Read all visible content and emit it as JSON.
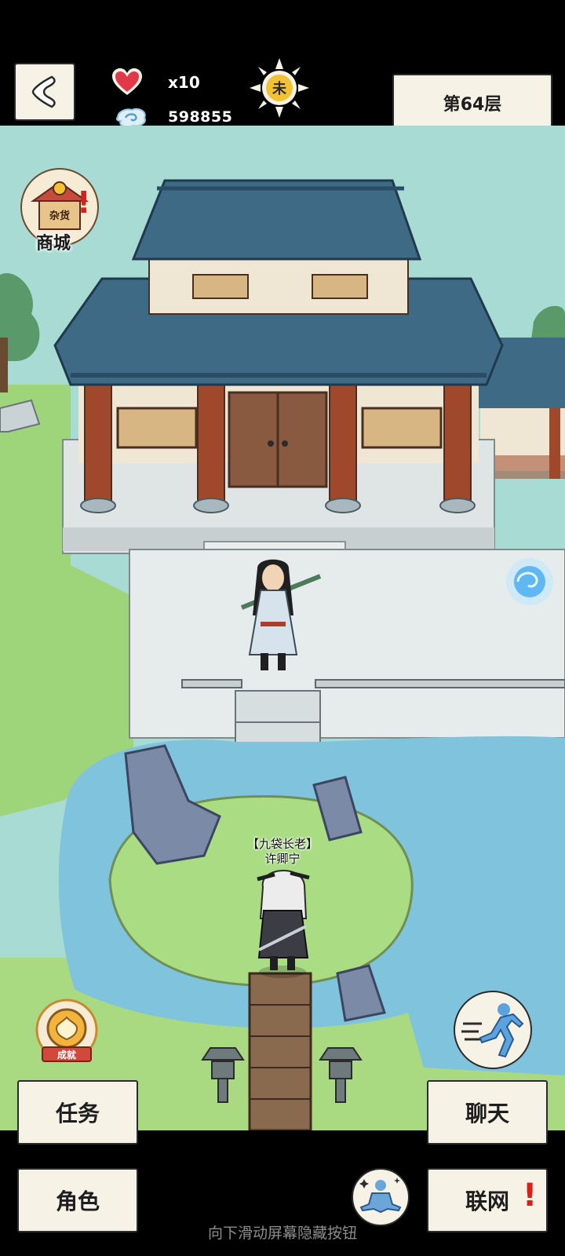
{
  "hud": {
    "lives": "x10",
    "currency": "598855",
    "time_glyph": "未",
    "floor": "第64层"
  },
  "scene": {
    "shop_sign": "杂货",
    "shop_label": "商城",
    "npc_title": "【九袋长老】",
    "npc_name": "许卿宁",
    "achievement_label": "成就"
  },
  "buttons": {
    "task": "任务",
    "chat": "聊天",
    "role": "角色",
    "network": "联网"
  },
  "hint": "向下滑动屏幕隐藏按钮",
  "colors": {
    "sky": "#a8dbd3",
    "grass": "#9ed47a",
    "water": "#7fc4dc",
    "roof": "#3f6a86",
    "pillar": "#a0482c",
    "paper": "#f6f2e6",
    "alert": "#d8201a"
  },
  "icons": [
    "back-arrow-icon",
    "heart-icon",
    "spirit-coin-icon",
    "sun-icon",
    "shop-icon",
    "achievement-icon",
    "run-icon",
    "meditate-icon",
    "portal-icon"
  ]
}
